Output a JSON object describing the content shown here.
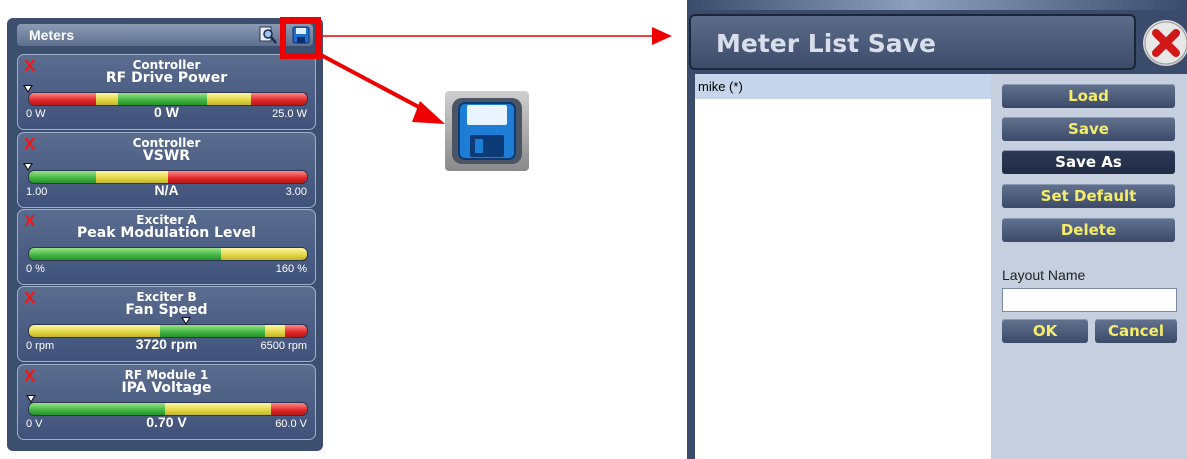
{
  "meters_panel": {
    "title": "Meters",
    "meters": [
      {
        "group": "Controller",
        "name": "RF Drive Power",
        "min": "0 W",
        "value": "0 W",
        "max": "25.0 W",
        "pointer_fraction": 0.0,
        "segments": [
          [
            "red",
            0.24
          ],
          [
            "yellow",
            0.08
          ],
          [
            "green",
            0.32
          ],
          [
            "yellow",
            0.16
          ],
          [
            "red",
            0.2
          ]
        ]
      },
      {
        "group": "Controller",
        "name": "VSWR",
        "min": "1.00",
        "value": "N/A",
        "max": "3.00",
        "pointer_fraction": 0.0,
        "segments": [
          [
            "green",
            0.24
          ],
          [
            "yellow",
            0.26
          ],
          [
            "red",
            0.5
          ]
        ]
      },
      {
        "group": "Exciter A",
        "name": "Peak Modulation Level",
        "min": "0 %",
        "value": "",
        "max": "160 %",
        "pointer_fraction": null,
        "segments": [
          [
            "green",
            0.69
          ],
          [
            "yellow",
            0.31
          ]
        ]
      },
      {
        "group": "Exciter B",
        "name": "Fan Speed",
        "min": "0 rpm",
        "value": "3720 rpm",
        "max": "6500 rpm",
        "pointer_fraction": 0.57,
        "segments": [
          [
            "yellow",
            0.47
          ],
          [
            "green",
            0.38
          ],
          [
            "yellow",
            0.07
          ],
          [
            "red",
            0.08
          ]
        ]
      },
      {
        "group": "RF Module 1",
        "name": "IPA Voltage",
        "min": "0 V",
        "value": "0.70 V",
        "max": "60.0 V",
        "pointer_fraction": 0.01,
        "segments": [
          [
            "green",
            0.49
          ],
          [
            "yellow",
            0.38
          ],
          [
            "red",
            0.13
          ]
        ]
      }
    ],
    "remove_glyph": "X"
  },
  "icons": {
    "zoom": "magnifier-icon",
    "save": "floppy-disk-save-icon",
    "close": "red-x-close-icon"
  },
  "dialog": {
    "title": "Meter List Save",
    "list_items": [
      "mike (*)"
    ],
    "buttons": {
      "load": "Load",
      "save": "Save",
      "save_as": "Save As",
      "set_default": "Set Default",
      "delete": "Delete",
      "ok": "OK",
      "cancel": "Cancel"
    },
    "layout_name_label": "Layout Name",
    "layout_name_value": ""
  },
  "colors": {
    "panel_bg": "#3d4f6e",
    "button_text": "#f4ec6a",
    "highlight": "#ee0000"
  }
}
